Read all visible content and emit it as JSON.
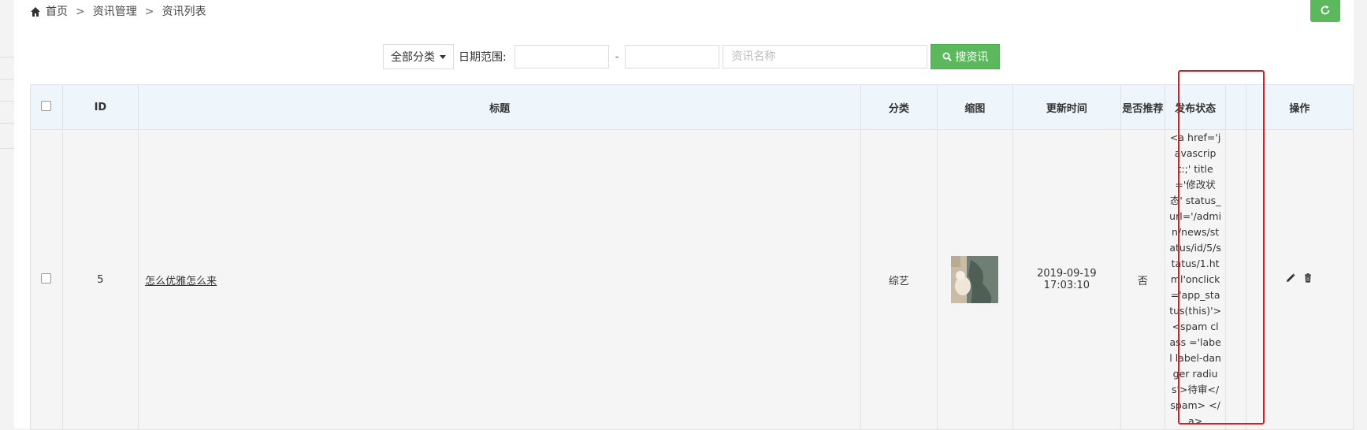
{
  "breadcrumb": {
    "items": [
      "首页",
      "资讯管理",
      "资讯列表"
    ],
    "separator": ">"
  },
  "toolbar": {
    "category_select": "全部分类",
    "date_label": "日期范围:",
    "date_separator": "-",
    "name_placeholder": "资讯名称",
    "search_label": "搜资讯"
  },
  "table": {
    "columns": [
      "ID",
      "标题",
      "分类",
      "缩图",
      "更新时间",
      "是否推荐",
      "发布状态",
      "",
      "操作"
    ],
    "rows": [
      {
        "id": "5",
        "title": "怎么优雅怎么来",
        "category": "综艺",
        "update_time": "2019-09-19 17:03:10",
        "recommended": "否",
        "status_html": "<a href='javascript:;' title='修改状态' status_url='/admin/news/status/id/5/status/1.html'onclick='app_status(this)'> <spam class ='label label-danger radius'>待审</spam> </a>"
      }
    ]
  },
  "colors": {
    "accent_green": "#5cb85c",
    "header_bg": "#eef6fb",
    "highlight_red": "#e5191d"
  }
}
